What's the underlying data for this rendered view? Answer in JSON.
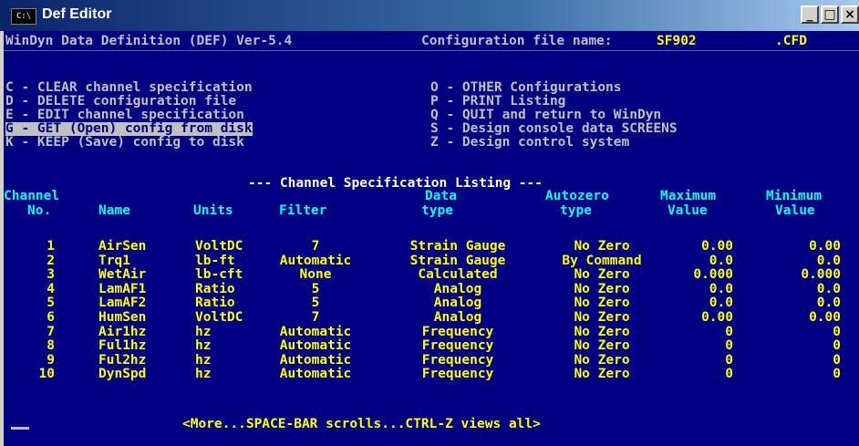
{
  "window": {
    "title": "Def Editor",
    "icon_label": "C:\\",
    "min_symbol": "_",
    "max_symbol": "□",
    "close_symbol": "×"
  },
  "header": {
    "program": "WinDyn Data Definition (DEF) Ver-5.4",
    "config_label": "Configuration file name:",
    "config_name": "SF902",
    "config_ext": ".CFD"
  },
  "menu_left": [
    "C - CLEAR channel specification",
    "D - DELETE configuration file",
    "E - EDIT channel specification",
    "G - GET (Open) config from disk",
    "K - KEEP (Save) config to disk"
  ],
  "menu_right": [
    "O - OTHER Configurations",
    "P - PRINT Listing",
    "Q - QUIT and return to WinDyn",
    "S - Design console data SCREENS",
    "Z - Design control system"
  ],
  "listing_title": "--- Channel Specification Listing ---",
  "columns": {
    "channel_1": "Channel",
    "channel_2": "No.",
    "name": "Name",
    "units": "Units",
    "filter": "Filter",
    "data_1": "Data",
    "data_2": "type",
    "auto_1": "Autozero",
    "auto_2": "type",
    "max_1": "Maximum",
    "max_2": "Value",
    "min_1": "Minimum",
    "min_2": "Value"
  },
  "rows": [
    {
      "no": "1",
      "name": "AirSen",
      "units": "VoltDC",
      "filter": "7",
      "data": "Strain Gauge",
      "auto": "No Zero",
      "max": "0.00",
      "min": "0.00"
    },
    {
      "no": "2",
      "name": "Trq1",
      "units": "lb-ft",
      "filter": "Automatic",
      "data": "Strain Gauge",
      "auto": "By Command",
      "max": "0.0",
      "min": "0.0"
    },
    {
      "no": "3",
      "name": "WetAir",
      "units": "lb-cft",
      "filter": "None",
      "data": "Calculated",
      "auto": "No Zero",
      "max": "0.000",
      "min": "0.000"
    },
    {
      "no": "4",
      "name": "LamAF1",
      "units": "Ratio",
      "filter": "5",
      "data": "Analog",
      "auto": "No Zero",
      "max": "0.0",
      "min": "0.0"
    },
    {
      "no": "5",
      "name": "LamAF2",
      "units": "Ratio",
      "filter": "5",
      "data": "Analog",
      "auto": "No Zero",
      "max": "0.0",
      "min": "0.0"
    },
    {
      "no": "6",
      "name": "HumSen",
      "units": "VoltDC",
      "filter": "7",
      "data": "Analog",
      "auto": "No Zero",
      "max": "0.00",
      "min": "0.00"
    },
    {
      "no": "7",
      "name": "Air1hz",
      "units": "hz",
      "filter": "Automatic",
      "data": "Frequency",
      "auto": "No Zero",
      "max": "0",
      "min": "0"
    },
    {
      "no": "8",
      "name": "Ful1hz",
      "units": "hz",
      "filter": "Automatic",
      "data": "Frequency",
      "auto": "No Zero",
      "max": "0",
      "min": "0"
    },
    {
      "no": "9",
      "name": "Ful2hz",
      "units": "hz",
      "filter": "Automatic",
      "data": "Frequency",
      "auto": "No Zero",
      "max": "0",
      "min": "0"
    },
    {
      "no": "10",
      "name": "DynSpd",
      "units": "hz",
      "filter": "Automatic",
      "data": "Frequency",
      "auto": "No Zero",
      "max": "0",
      "min": "0"
    }
  ],
  "footer": "<More...SPACE-BAR scrolls...CTRL-Z views all>",
  "colors": {
    "background": "#000080",
    "text": "#c0c0c0",
    "header": "#00ffff",
    "values": "#ffff00"
  }
}
